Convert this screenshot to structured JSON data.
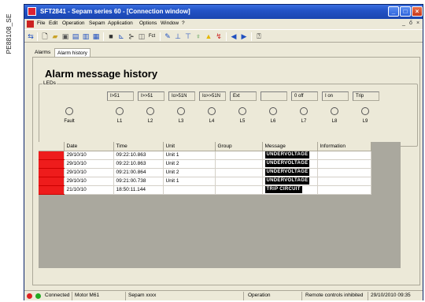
{
  "side_code": "PE88108_SE",
  "window": {
    "title": "SFT2841 - Sepam series 60 - [Connection window]"
  },
  "menu": [
    "File",
    "Edit",
    "Operation",
    "Sepam",
    "Application",
    "Options",
    "Window",
    "?"
  ],
  "mdi_controls": [
    "_",
    "ő",
    "×"
  ],
  "tabs": [
    {
      "label": "Alarms",
      "active": false
    },
    {
      "label": "Alarm history",
      "active": true
    }
  ],
  "panel": {
    "title": "Alarm message history",
    "leds_legend": "LEDs",
    "led_labels": [
      "I>51",
      "I>>51",
      "Io>51N",
      "Io>>51N",
      "Ext",
      "",
      "0 off",
      "I on",
      "Trip"
    ],
    "leds": [
      "Fault",
      "L1",
      "L2",
      "L3",
      "L4",
      "L5",
      "L6",
      "L7",
      "L8",
      "L9"
    ]
  },
  "grid": {
    "columns": [
      "Date",
      "Time",
      "Unit",
      "Group",
      "Message",
      "Information"
    ],
    "rows": [
      {
        "date": "29/10/10",
        "time": "09:22:10.863",
        "unit": "Unit 1",
        "group": "",
        "message": "UNDERVOLTAGE",
        "information": ""
      },
      {
        "date": "29/10/10",
        "time": "09:22:10.863",
        "unit": "Unit 2",
        "group": "",
        "message": "UNDERVOLTAGE",
        "information": ""
      },
      {
        "date": "29/10/10",
        "time": "09:21:00.864",
        "unit": "Unit 2",
        "group": "",
        "message": "UNDERVOLTAGE",
        "information": ""
      },
      {
        "date": "29/10/10",
        "time": "09:21:00.738",
        "unit": "Unit 1",
        "group": "",
        "message": "UNDERVOLTAGE",
        "information": ""
      },
      {
        "date": "21/10/10",
        "time": "18:50:11.144",
        "unit": "",
        "group": "",
        "message": "TRIP CIRCUIT",
        "information": ""
      }
    ],
    "marker_color": "#ee1c1c"
  },
  "status": {
    "connection": "Connected",
    "motor": "Motor M61",
    "sepam": "Sepam xxxx",
    "mode": "Operation",
    "remote": "Remote controls inhibited",
    "datetime": "29/10/2010 09:35"
  },
  "colors": {
    "titlebar": "#2353c6",
    "alarm_red": "#ee1c1c",
    "status_green": "#22aa22"
  }
}
